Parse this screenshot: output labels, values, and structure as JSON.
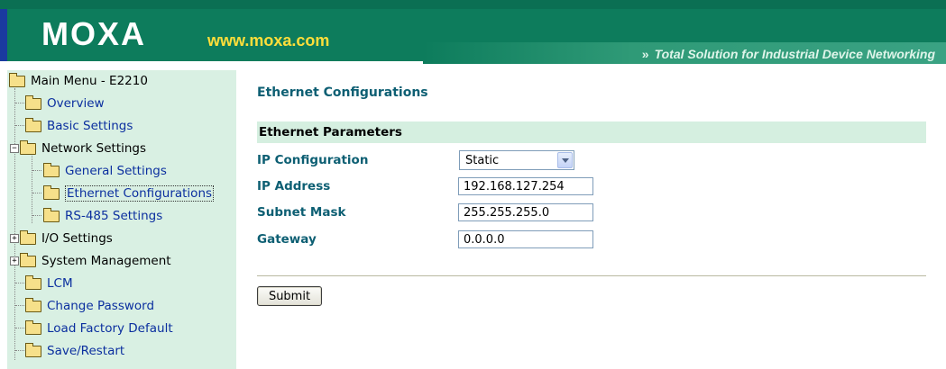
{
  "header": {
    "logo_text": "MOXA",
    "url": "www.moxa.com",
    "tagline_arrows": "»",
    "tagline": "Total Solution for Industrial Device Networking",
    "colors": {
      "band": "#0d7c5c",
      "url": "#ffde3a",
      "accent_strip": "#1a3aa0"
    }
  },
  "sidebar": {
    "root": "Main Menu - E2210",
    "items": {
      "overview": "Overview",
      "basic_settings": "Basic Settings",
      "network_settings": "Network Settings",
      "general_settings": "General Settings",
      "ethernet_configurations": "Ethernet Configurations",
      "rs485_settings": "RS-485 Settings",
      "io_settings": "I/O Settings",
      "system_management": "System Management",
      "lcm": "LCM",
      "change_password": "Change Password",
      "load_factory_default": "Load Factory Default",
      "save_restart": "Save/Restart"
    },
    "expanders": {
      "minus": "−",
      "plus": "+"
    },
    "selected": "Ethernet Configurations"
  },
  "main": {
    "page_title": "Ethernet Configurations",
    "section_title": "Ethernet Parameters",
    "fields": {
      "ip_configuration": {
        "label": "IP Configuration",
        "value": "Static"
      },
      "ip_address": {
        "label": "IP Address",
        "value": "192.168.127.254"
      },
      "subnet_mask": {
        "label": "Subnet Mask",
        "value": "255.255.255.0"
      },
      "gateway": {
        "label": "Gateway",
        "value": "0.0.0.0"
      }
    },
    "submit_label": "Submit"
  }
}
